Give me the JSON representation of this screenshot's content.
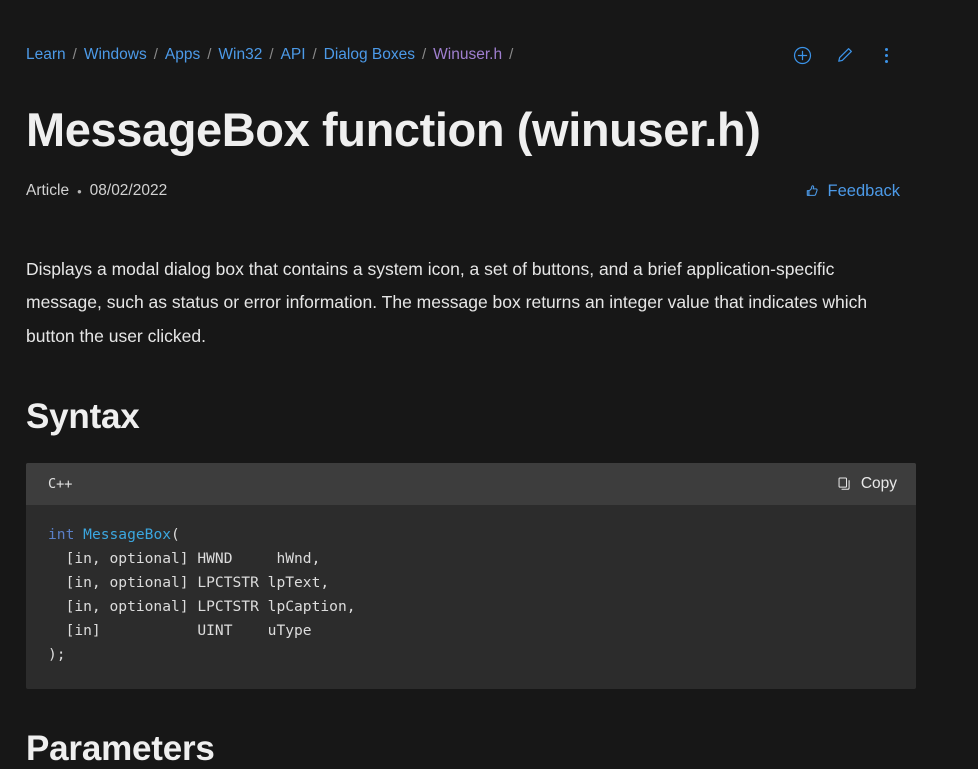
{
  "breadcrumb": {
    "separator": "/",
    "items": [
      {
        "label": "Learn",
        "visited": false
      },
      {
        "label": "Windows",
        "visited": false
      },
      {
        "label": "Apps",
        "visited": false
      },
      {
        "label": "Win32",
        "visited": false
      },
      {
        "label": "API",
        "visited": false
      },
      {
        "label": "Dialog Boxes",
        "visited": false
      },
      {
        "label": "Winuser.h",
        "visited": true
      }
    ]
  },
  "header_actions": [
    {
      "name": "add-icon",
      "label": "Add"
    },
    {
      "name": "edit-pencil-icon",
      "label": "Edit"
    },
    {
      "name": "more-options-icon",
      "label": "More options"
    }
  ],
  "page": {
    "title": "MessageBox function (winuser.h)",
    "content_type": "Article",
    "bullet": "•",
    "date": "08/02/2022",
    "feedback_label": "Feedback",
    "lead": "Displays a modal dialog box that contains a system icon, a set of buttons, and a brief application-specific message, such as status or error information. The message box returns an integer value that indicates which button the user clicked."
  },
  "sections": {
    "syntax_heading": "Syntax",
    "parameters_heading": "Parameters"
  },
  "code": {
    "language": "C++",
    "copy_label": "Copy",
    "lines": [
      {
        "kw": "int",
        "fn": "MessageBox",
        "tail": "("
      },
      {
        "plain": "  [in, optional] HWND     hWnd,"
      },
      {
        "plain": "  [in, optional] LPCTSTR lpText,"
      },
      {
        "plain": "  [in, optional] LPCTSTR lpCaption,"
      },
      {
        "plain": "  [in]           UINT    uType"
      },
      {
        "plain": ");"
      }
    ],
    "text": "int MessageBox(\n  [in, optional] HWND     hWnd,\n  [in, optional] LPCTSTR lpText,\n  [in, optional] LPCTSTR lpCaption,\n  [in]           UINT    uType\n);"
  },
  "colors": {
    "background": "#171717",
    "link": "#4c9ae8",
    "visited_link": "#a07fd0",
    "text": "#e6e6e6",
    "code_header_bg": "#3d3d3d",
    "code_body_bg": "#2c2c2c",
    "keyword": "#5a7fc6",
    "function": "#3ba7e0"
  }
}
